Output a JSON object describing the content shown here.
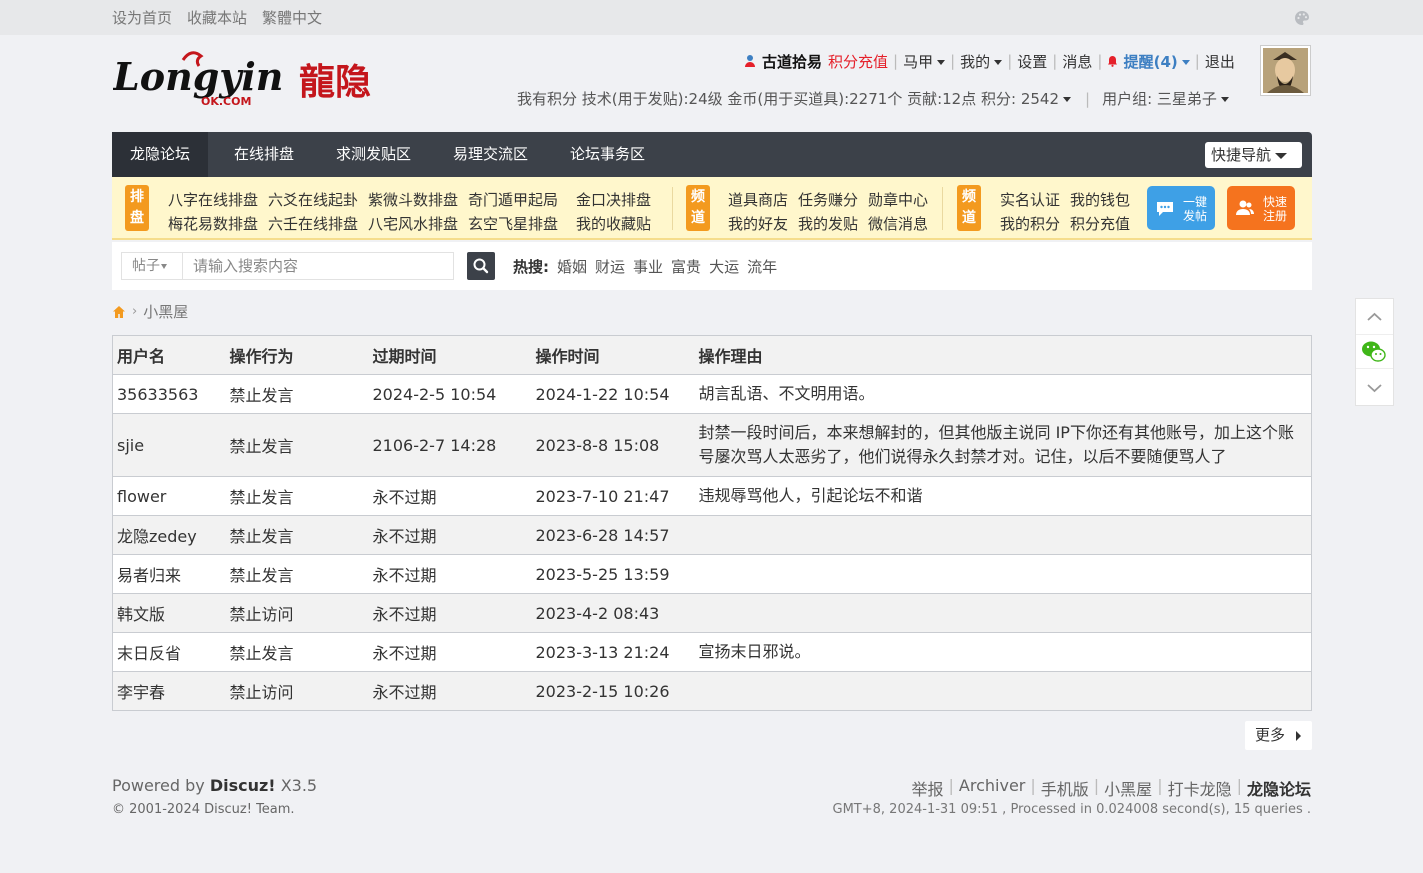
{
  "topbar": {
    "links": [
      "设为首页",
      "收藏本站",
      "繁體中文"
    ],
    "palette_icon": "palette-icon"
  },
  "logo": {
    "text_latin": "Longyin",
    "text_sub": "OK.COM",
    "text_cn": "龍隐"
  },
  "user": {
    "name": "古道拾易",
    "recharge": "积分充值",
    "menus": [
      "马甲",
      "我的",
      "设置",
      "消息"
    ],
    "remind": "提醒(4)",
    "logout": "退出"
  },
  "credits": {
    "text": "我有积分 技术(用于发贴):24级 金币(用于买道具):2271个 贡献:12点 积分: 2542",
    "usergroup": "用户组: 三星弟子"
  },
  "nav": {
    "tabs": [
      "龙隐论坛",
      "在线排盘",
      "求测发贴区",
      "易理交流区",
      "论坛事务区"
    ],
    "quick": "快捷导航"
  },
  "subnav": {
    "group1": {
      "badge": "排盘",
      "row1": [
        "八字在线排盘",
        "六爻在线起卦",
        "紫微斗数排盘",
        "奇门遁甲起局",
        "金口决排盘"
      ],
      "row2": [
        "梅花易数排盘",
        "六壬在线排盘",
        "八宅风水排盘",
        "玄空飞星排盘",
        "我的收藏贴"
      ]
    },
    "group2": {
      "badge": "频道",
      "row1": [
        "道具商店",
        "任务赚分",
        "勋章中心"
      ],
      "row2": [
        "我的好友",
        "我的发贴",
        "微信消息"
      ]
    },
    "group3": {
      "badge": "频道",
      "row1": [
        "实名认证",
        "我的钱包"
      ],
      "row2": [
        "我的积分",
        "积分充值"
      ]
    },
    "btn_post": "一键发帖",
    "btn_register": "快速注册"
  },
  "search": {
    "type": "帖子",
    "placeholder": "请输入搜索内容",
    "hot_label": "热搜:",
    "hot": [
      "婚姻",
      "财运",
      "事业",
      "富贵",
      "大运",
      "流年"
    ]
  },
  "breadcrumb": {
    "current": "小黑屋"
  },
  "table": {
    "headers": [
      "用户名",
      "操作行为",
      "过期时间",
      "操作时间",
      "操作理由"
    ],
    "rows": [
      [
        "35633563",
        "禁止发言",
        "2024-2-5 10:54",
        "2024-1-22 10:54",
        "胡言乱语、不文明用语。"
      ],
      [
        "sjie",
        "禁止发言",
        "2106-2-7 14:28",
        "2023-8-8 15:08",
        "封禁一段时间后，本来想解封的，但其他版主说同 IP下你还有其他账号，加上这个账号屡次骂人太恶劣了，他们说得永久封禁才对。记住，以后不要随便骂人了"
      ],
      [
        "flower",
        "禁止发言",
        "永不过期",
        "2023-7-10 21:47",
        "违规辱骂他人，引起论坛不和谐"
      ],
      [
        "龙隐zedey",
        "禁止发言",
        "永不过期",
        "2023-6-28 14:57",
        ""
      ],
      [
        "易者归来",
        "禁止发言",
        "永不过期",
        "2023-5-25 13:59",
        ""
      ],
      [
        "韩文版",
        "禁止访问",
        "永不过期",
        "2023-4-2 08:43",
        ""
      ],
      [
        "末日反省",
        "禁止发言",
        "永不过期",
        "2023-3-13 21:24",
        "宣扬末日邪说。"
      ],
      [
        "李宇春",
        "禁止访问",
        "永不过期",
        "2023-2-15 10:26",
        ""
      ]
    ]
  },
  "more": "更多",
  "footer": {
    "powered_prefix": "Powered by ",
    "powered_brand": "Discuz!",
    "powered_version": " X3.5",
    "copyright": "© 2001-2024 Discuz! Team.",
    "links": [
      "举报",
      "Archiver",
      "手机版",
      "小黑屋",
      "打卡龙隐"
    ],
    "site": "龙隐论坛",
    "processed": "GMT+8, 2024-1-31 09:51 , Processed in 0.024008 second(s), 15 queries ."
  },
  "colors": {
    "nav_bg": "#3c4149",
    "accent_orange": "#f39a1f",
    "accent_red": "#e5202a",
    "remind_blue": "#3d7fc2"
  }
}
